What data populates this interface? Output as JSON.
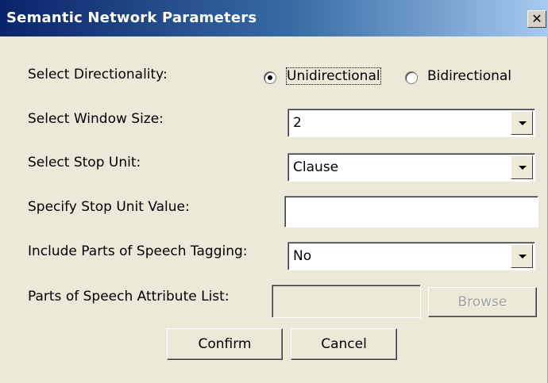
{
  "window": {
    "title": "Semantic Network Parameters",
    "close_glyph": "✕"
  },
  "directionality": {
    "label": "Select Directionality:",
    "options": [
      "Unidirectional",
      "Bidirectional"
    ],
    "selected": "Unidirectional"
  },
  "window_size": {
    "label": "Select Window Size:",
    "value": "2"
  },
  "stop_unit": {
    "label": "Select Stop Unit:",
    "value": "Clause"
  },
  "stop_unit_value": {
    "label": "Specify Stop Unit Value:",
    "value": ""
  },
  "pos_tagging": {
    "label": "Include Parts of Speech Tagging:",
    "value": "No"
  },
  "pos_attribute_list": {
    "label": "Parts of Speech Attribute List:",
    "value": "",
    "browse_label": "Browse"
  },
  "buttons": {
    "confirm": "Confirm",
    "cancel": "Cancel"
  },
  "colors": {
    "titlebar_start": "#0a246a",
    "titlebar_end": "#a6caf0",
    "dialog_bg": "#ece9d8"
  }
}
